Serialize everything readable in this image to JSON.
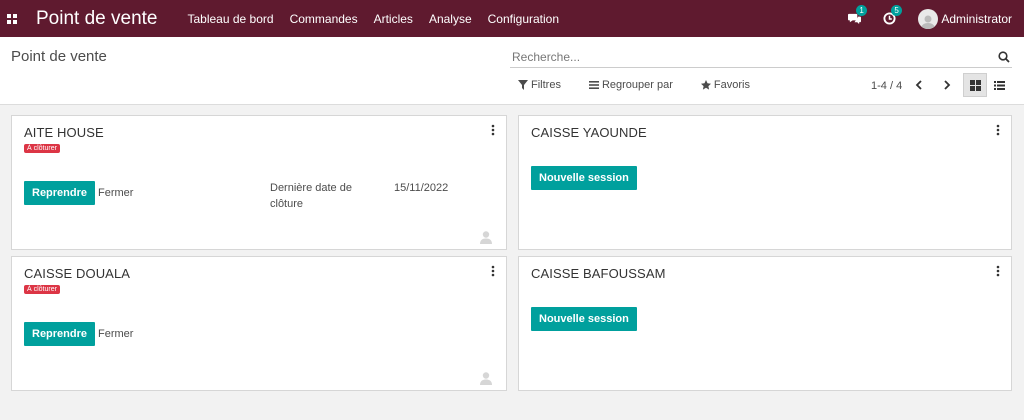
{
  "navbar": {
    "apps_icon": "grid-icon",
    "brand": "Point de vente",
    "menu": [
      "Tableau de bord",
      "Commandes",
      "Articles",
      "Analyse",
      "Configuration"
    ],
    "messages_badge": "1",
    "activities_badge": "5",
    "user_name": "Administrator"
  },
  "control": {
    "breadcrumb": "Point de vente",
    "search_placeholder": "Recherche...",
    "filters_label": "Filtres",
    "group_by_label": "Regrouper par",
    "favorites_label": "Favoris",
    "pager": "1-4 / 4"
  },
  "cards": [
    {
      "title": "AITE HOUSE",
      "badge": "À clôturer",
      "primary_label": "Reprendre",
      "secondary_label": "Fermer",
      "meta_label": "Dernière date de clôture",
      "meta_value": "15/11/2022"
    },
    {
      "title": "CAISSE YAOUNDE",
      "primary_label": "Nouvelle session"
    },
    {
      "title": "CAISSE DOUALA",
      "badge": "À clôturer",
      "primary_label": "Reprendre",
      "secondary_label": "Fermer"
    },
    {
      "title": "CAISSE BAFOUSSAM",
      "primary_label": "Nouvelle session"
    }
  ],
  "colors": {
    "navbar": "#5f1a2f",
    "primary": "#00a09d",
    "danger": "#dc3545"
  }
}
